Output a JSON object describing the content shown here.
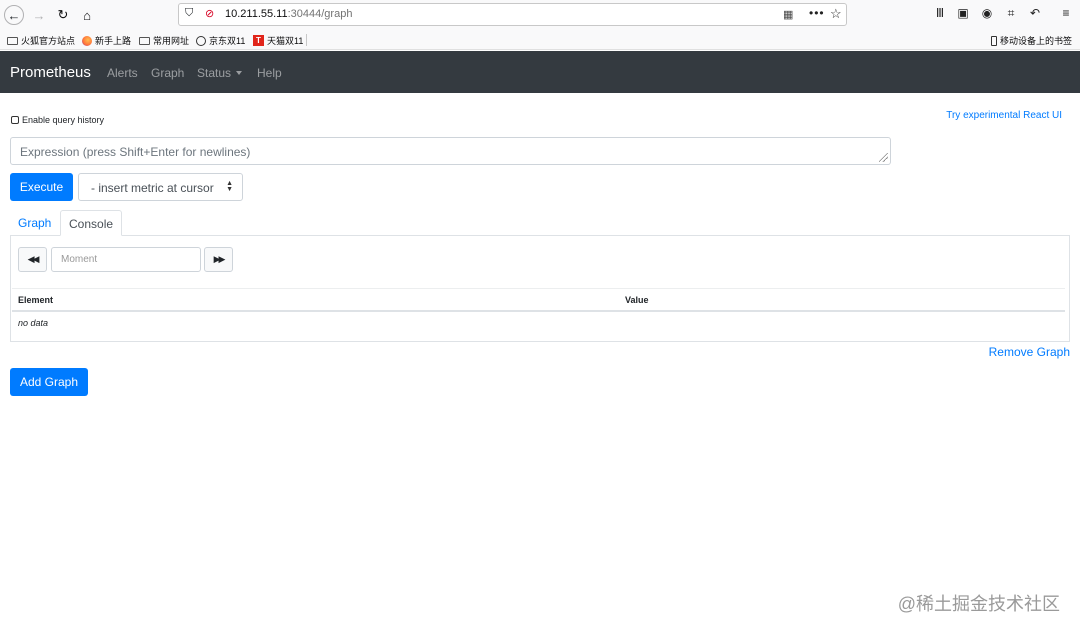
{
  "browser": {
    "url_host": "10.211.55.11",
    "url_rest": ":30444/graph",
    "bookmarks": [
      "火狐官方站点",
      "新手上路",
      "常用网址",
      "京东双11",
      "天猫双11"
    ],
    "tmall_badge": "T",
    "mobile_bookmarks": "移动设备上的书签"
  },
  "navbar": {
    "brand": "Prometheus",
    "links": [
      "Alerts",
      "Graph",
      "Status",
      "Help"
    ]
  },
  "page": {
    "history_label": "Enable query history",
    "react_link": "Try experimental React UI",
    "expression_placeholder": "Expression (press Shift+Enter for newlines)",
    "execute_label": "Execute",
    "metric_select": "- insert metric at cursor",
    "tabs": [
      "Graph",
      "Console"
    ],
    "moment_placeholder": "Moment",
    "table_headers": [
      "Element",
      "Value"
    ],
    "no_data": "no data",
    "remove_graph": "Remove Graph",
    "add_graph": "Add Graph"
  },
  "watermark": "@稀土掘金技术社区",
  "colors": {
    "navbar_bg": "#343a40",
    "primary": "#007bff"
  }
}
